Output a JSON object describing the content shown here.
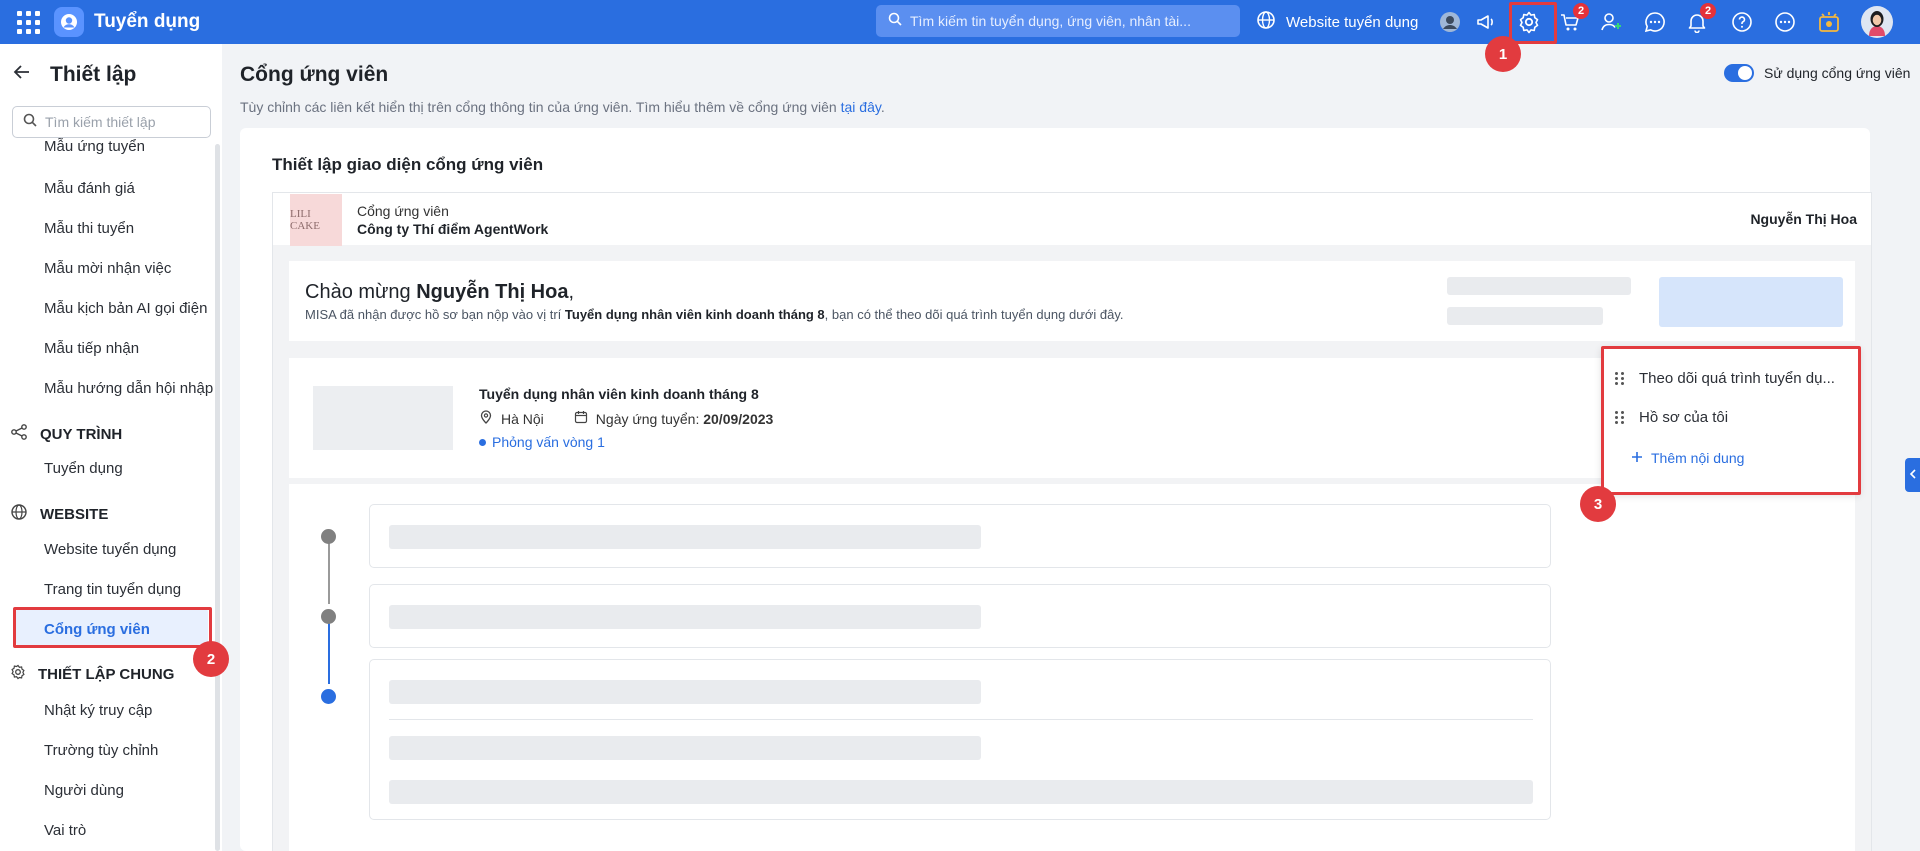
{
  "app": {
    "title": "Tuyển dụng",
    "search_placeholder": "Tìm kiếm tin tuyển dụng, ứng viên, nhân tài...",
    "website_link": "Website tuyển dụng",
    "badges": {
      "cart": "2",
      "notifications": "2"
    },
    "colors": {
      "topbar": "#2a6ee0",
      "accent": "#2a6ee0",
      "highlight": "#e23b3f"
    }
  },
  "steps": {
    "one": "1",
    "two": "2",
    "three": "3"
  },
  "sidebar": {
    "title": "Thiết lập",
    "search_placeholder": "Tìm kiếm thiết lập",
    "items": [
      "Mẫu ứng tuyển",
      "Mẫu đánh giá",
      "Mẫu thi tuyển",
      "Mẫu mời nhận việc",
      "Mẫu kịch bản AI gọi điện",
      "Mẫu tiếp nhận",
      "Mẫu hướng dẫn hội nhập"
    ],
    "section_process": "QUY TRÌNH",
    "process_items": [
      "Tuyển dụng"
    ],
    "section_website": "WEBSITE",
    "website_items": [
      "Website tuyển dụng",
      "Trang tin tuyển dụng",
      "Cổng ứng viên"
    ],
    "section_general": "THIẾT LẬP CHUNG",
    "general_items": [
      "Nhật ký truy cập",
      "Trường tùy chỉnh",
      "Người dùng",
      "Vai trò"
    ]
  },
  "main": {
    "title": "Cổng ứng viên",
    "description": "Tùy chỉnh các liên kết hiển thị trên cổng thông tin của ứng viên. Tìm hiểu thêm về cổng ứng viên ",
    "description_link": "tại đây",
    "description_end": ".",
    "toggle_label": "Sử dụng cổng ứng viên",
    "toggle_on": true,
    "card_title": "Thiết lập giao diện cổng ứng viên"
  },
  "preview": {
    "logo_text": "LILI CAKE",
    "portal_label": "Cổng ứng viên",
    "company": "Công ty Thí điểm AgentWork",
    "user": "Nguyễn Thị Hoa",
    "welcome_prefix": "Chào mừng ",
    "welcome_name": "Nguyễn Thị Hoa",
    "welcome_suffix": ",",
    "welcome_text_1": "MISA đã nhận được hồ sơ bạn nộp vào vị trí ",
    "welcome_position": "Tuyển dụng nhân viên kinh doanh tháng 8",
    "welcome_text_2": ", bạn có thể theo dõi quá trình tuyển dụng dưới đây.",
    "job_title": "Tuyển dụng nhân viên kinh doanh tháng 8",
    "job_location": "Hà Nội",
    "job_date_label": "Ngày ứng tuyển: ",
    "job_date": "20/09/2023",
    "job_status": "Phỏng vấn vòng 1"
  },
  "menu_panel": {
    "items": [
      "Theo dõi quá trình tuyển dụ...",
      "Hồ sơ của tôi"
    ],
    "add_label": "Thêm nội dung"
  }
}
